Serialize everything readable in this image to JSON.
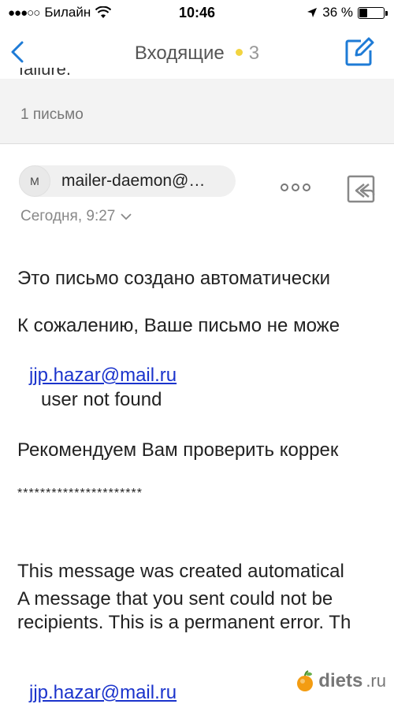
{
  "status_bar": {
    "carrier": "Билайн",
    "time": "10:46",
    "battery_percent": "36 %",
    "battery_level": 0.36
  },
  "nav": {
    "title": "Входящие",
    "unread_count": "3",
    "dot_color": "#f2d440",
    "accent_color": "#1e7bd6"
  },
  "thread": {
    "subject_partial": "failure.",
    "message_count": "1 письмо"
  },
  "message": {
    "avatar_initial": "M",
    "sender": "mailer-daemon@…",
    "date": "Сегодня, 9:27",
    "body": {
      "ru_intro": "Это письмо создано автоматически",
      "ru_sorry": "К сожалению, Ваше письмо не може",
      "address_1": "jjp.hazar@mail.ru",
      "not_found": "user not found",
      "ru_recommend": "Рекомендуем Вам проверить коррек",
      "separator": "**********************",
      "en_intro": "This message was created automatical",
      "en_line1": "A message that you sent could not be",
      "en_line2": "recipients. This is a permanent error. Th",
      "address_2": "jjp.hazar@mail.ru"
    }
  },
  "watermark": {
    "brand": "diets",
    "tld": ".ru"
  }
}
